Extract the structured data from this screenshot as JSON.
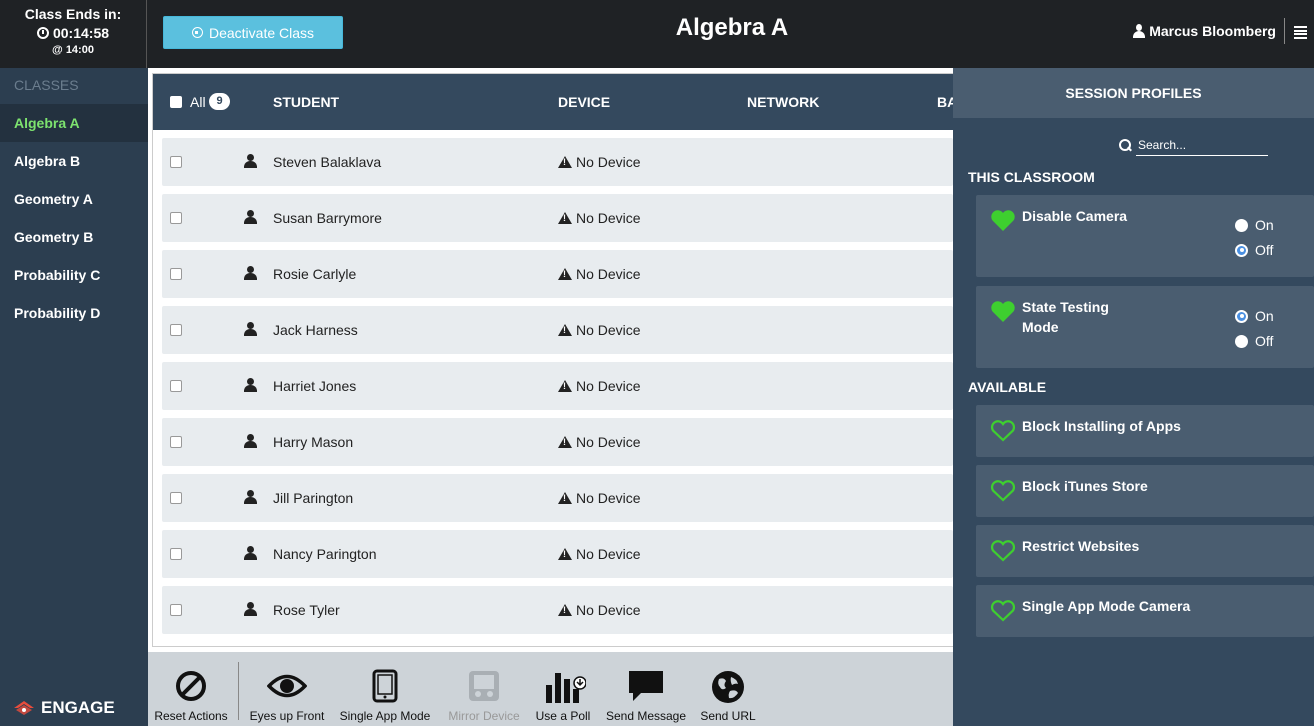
{
  "header": {
    "class_ends_label": "Class Ends in:",
    "countdown": "00:14:58",
    "end_time": "@ 14:00",
    "deactivate_label": "Deactivate Class",
    "title": "Algebra A",
    "user_name": "Marcus Bloomberg"
  },
  "sidebar": {
    "header": "CLASSES",
    "items": [
      {
        "label": "Algebra A",
        "active": true
      },
      {
        "label": "Algebra B"
      },
      {
        "label": "Geometry A"
      },
      {
        "label": "Geometry B"
      },
      {
        "label": "Probability C"
      },
      {
        "label": "Probability D"
      }
    ],
    "brand": "ENGAGE"
  },
  "table": {
    "all_label": "All",
    "count": "9",
    "columns": [
      "STUDENT",
      "DEVICE",
      "NETWORK",
      "BA"
    ],
    "rows": [
      {
        "name": "Steven Balaklava",
        "device": "No Device"
      },
      {
        "name": "Susan Barrymore",
        "device": "No Device"
      },
      {
        "name": "Rosie Carlyle",
        "device": "No Device"
      },
      {
        "name": "Jack Harness",
        "device": "No Device"
      },
      {
        "name": "Harriet Jones",
        "device": "No Device"
      },
      {
        "name": "Harry Mason",
        "device": "No Device"
      },
      {
        "name": "Jill Parington",
        "device": "No Device"
      },
      {
        "name": "Nancy Parington",
        "device": "No Device"
      },
      {
        "name": "Rose Tyler",
        "device": "No Device"
      }
    ]
  },
  "profiles": {
    "header": "SESSION PROFILES",
    "search_placeholder": "Search...",
    "this_classroom_label": "THIS CLASSROOM",
    "available_label": "AVAILABLE",
    "on_label": "On",
    "off_label": "Off",
    "classroom": [
      {
        "title_l1": "Disable Camera",
        "title_l2": "",
        "selected": "Off"
      },
      {
        "title_l1": "State Testing",
        "title_l2": "Mode",
        "selected": "On"
      }
    ],
    "available": [
      "Block Installing of Apps",
      "Block iTunes Store",
      "Restrict Websites",
      "Single App Mode Camera"
    ],
    "heart_color": "#3ecf2f"
  },
  "toolbar": {
    "reset": "Reset Actions",
    "eyes_up": "Eyes up Front",
    "single_app": "Single App Mode",
    "mirror": "Mirror Device",
    "poll": "Use a Poll",
    "message": "Send Message",
    "url": "Send URL"
  }
}
